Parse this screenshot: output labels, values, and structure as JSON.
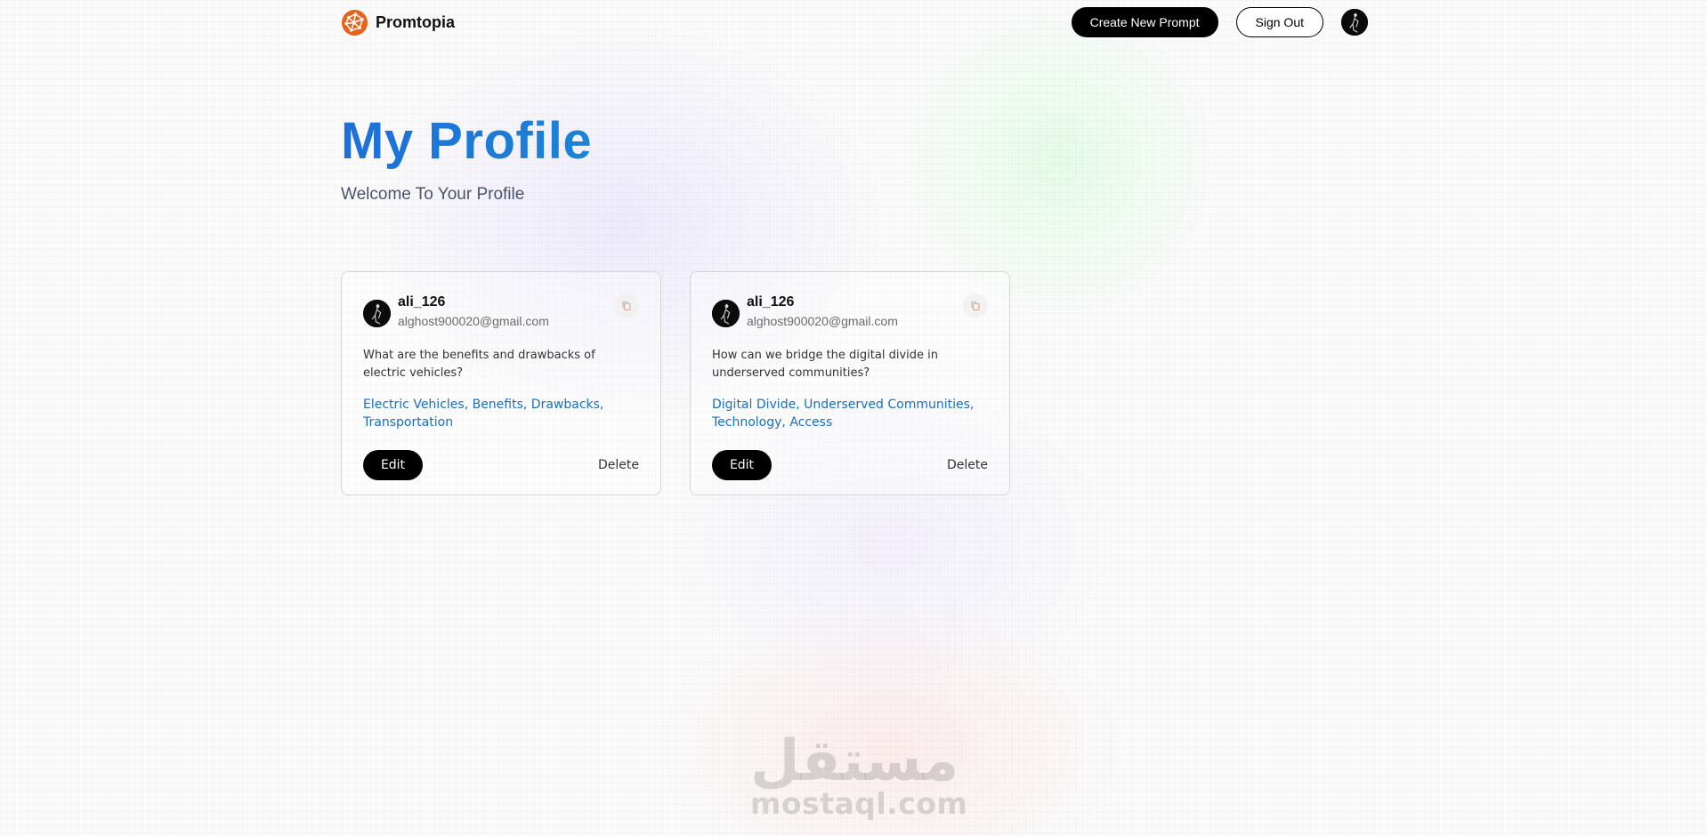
{
  "app": {
    "name": "Promtopia"
  },
  "nav": {
    "create_label": "Create New Prompt",
    "signout_label": "Sign Out"
  },
  "header": {
    "title": "My Profile",
    "subtitle": "Welcome To Your Profile"
  },
  "cards": [
    {
      "username": "ali_126",
      "email": "alghost900020@gmail.com",
      "prompt": "What are the benefits and drawbacks of electric vehicles?",
      "tags": "Electric Vehicles, Benefits, Drawbacks, Transportation",
      "edit_label": "Edit",
      "delete_label": "Delete"
    },
    {
      "username": "ali_126",
      "email": "alghost900020@gmail.com",
      "prompt": "How can we bridge the digital divide in underserved communities?",
      "tags": "Digital Divide, Underserved Communities, Technology, Access",
      "edit_label": "Edit",
      "delete_label": "Delete"
    }
  ],
  "watermark": {
    "arabic": "مستقل",
    "latin": "mostaql.com"
  },
  "colors": {
    "title_gradient_start": "#1e6fd9",
    "title_gradient_end": "#1a84d6",
    "tag_blue": "#1a6fbf",
    "logo_orange": "#e8621c"
  },
  "icons": {
    "logo": "globe-network-icon",
    "avatar": "user-avatar-icon",
    "copy": "copy-icon"
  }
}
